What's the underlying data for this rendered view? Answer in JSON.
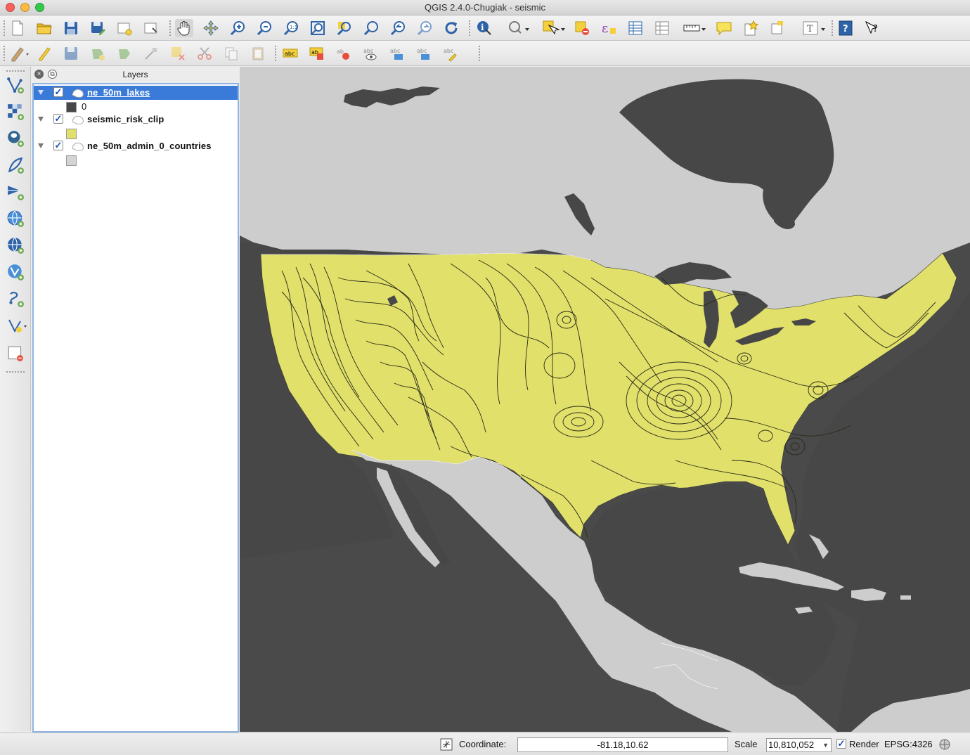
{
  "window": {
    "title": "QGIS 2.4.0-Chugiak - seismic"
  },
  "layers_panel": {
    "title": "Layers",
    "layers": [
      {
        "name": "ne_50m_lakes",
        "checked": true,
        "selected": true,
        "legend_label": "0",
        "legend_color": "#474747"
      },
      {
        "name": "seismic_risk_clip",
        "checked": true,
        "selected": false,
        "legend_label": "",
        "legend_color": "#e0e06a"
      },
      {
        "name": "ne_50m_admin_0_countries",
        "checked": true,
        "selected": false,
        "legend_label": "",
        "legend_color": "#d4d4d4"
      }
    ]
  },
  "map": {
    "background_color": "#4a4a4a",
    "land_color": "#cdcdcd",
    "seismic_fill_color": "#e0e06a",
    "lake_color": "#474747"
  },
  "status_bar": {
    "coordinate_label": "Coordinate:",
    "coordinate_value": "-81.18,10.62",
    "scale_label": "Scale",
    "scale_value": "10,810,052",
    "render_label": "Render",
    "render_checked": true,
    "crs": "EPSG:4326"
  },
  "icons": {
    "toolbar_1": [
      "new-project-icon",
      "open-project-icon",
      "save-project-icon",
      "save-as-icon",
      "new-print-composer-icon",
      "composer-manager-icon",
      "pan-icon",
      "pan-to-selection-icon",
      "zoom-in-icon",
      "zoom-out-icon",
      "zoom-actual-icon",
      "zoom-full-icon",
      "zoom-to-selection-icon",
      "zoom-to-layer-icon",
      "zoom-last-icon",
      "zoom-next-icon",
      "refresh-icon",
      "identify-icon",
      "action-icon",
      "select-features-icon",
      "deselect-icon",
      "expression-select-icon",
      "attribute-table-icon",
      "statistics-icon",
      "measure-icon",
      "map-tips-icon",
      "new-bookmark-icon",
      "show-bookmarks-icon",
      "text-annotation-icon",
      "help-icon",
      "whats-this-icon"
    ],
    "toolbar_2": [
      "current-edits-icon",
      "toggle-editing-icon",
      "save-edits-icon",
      "add-feature-icon",
      "move-feature-icon",
      "node-tool-icon",
      "delete-selected-icon",
      "cut-features-icon",
      "copy-features-icon",
      "paste-features-icon",
      "label-icon",
      "label-highlight-icon",
      "pin-label-icon",
      "show-hide-labels-icon",
      "move-label-icon",
      "rotate-label-icon",
      "change-label-icon"
    ],
    "vertical": [
      "add-vector-layer-icon",
      "add-raster-layer-icon",
      "add-postgis-layer-icon",
      "add-spatialite-layer-icon",
      "add-mssql-layer-icon",
      "add-wms-layer-icon",
      "add-wcs-layer-icon",
      "add-wfs-layer-icon",
      "add-delimited-text-icon",
      "new-shapefile-icon",
      "remove-layer-icon"
    ]
  }
}
